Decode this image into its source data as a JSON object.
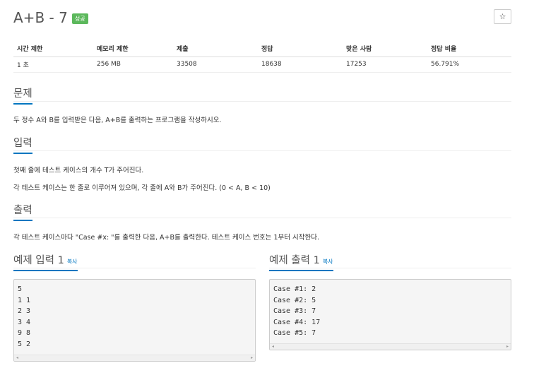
{
  "problem": {
    "title": "A+B - 7",
    "badge": "성공",
    "star_icon": "☆"
  },
  "info_table": {
    "headers": [
      "시간 제한",
      "메모리 제한",
      "제출",
      "정답",
      "맞은 사람",
      "정답 비율"
    ],
    "values": [
      "1 초",
      "256 MB",
      "33508",
      "18638",
      "17253",
      "56.791%"
    ]
  },
  "sections": {
    "problem": {
      "heading": "문제",
      "text": "두 정수 A와 B를 입력받은 다음, A+B를 출력하는 프로그램을 작성하시오."
    },
    "input": {
      "heading": "입력",
      "line1": "첫째 줄에 테스트 케이스의 개수 T가 주어진다.",
      "line2": "각 테스트 케이스는 한 줄로 이루어져 있으며, 각 줄에 A와 B가 주어진다. (0 < A, B < 10)"
    },
    "output": {
      "heading": "출력",
      "text": "각 테스트 케이스마다 \"Case #x: \"를 출력한 다음, A+B를 출력한다. 테스트 케이스 번호는 1부터 시작한다."
    }
  },
  "samples": {
    "input": {
      "heading": "예제 입력 1",
      "copy": "복사",
      "content": "5\n1 1\n2 3\n3 4\n9 8\n5 2"
    },
    "output": {
      "heading": "예제 출력 1",
      "copy": "복사",
      "content": "Case #1: 2\nCase #2: 5\nCase #3: 7\nCase #4: 17\nCase #5: 7"
    }
  },
  "icons": {
    "scroll_left": "◂",
    "scroll_right": "▸"
  },
  "colors": {
    "accent": "#0076c0",
    "success": "#5cb85c"
  }
}
